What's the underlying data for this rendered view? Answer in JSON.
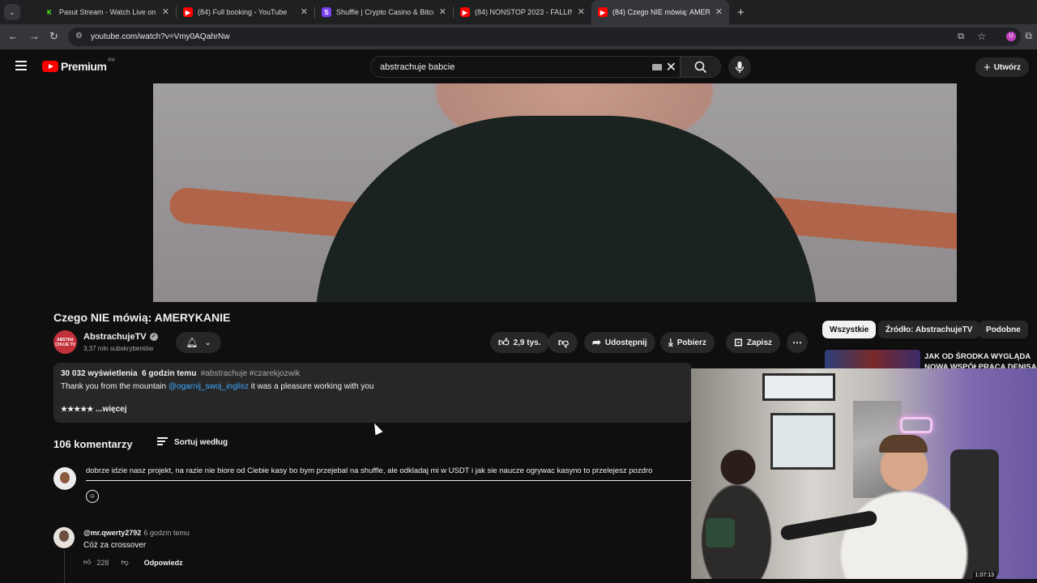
{
  "browser": {
    "tabs": [
      {
        "title": "Pasut Stream - Watch Live on K",
        "favicon": "kick-icon",
        "color": "#53fc18",
        "glyph": "K"
      },
      {
        "title": "(84) Full booking - YouTube",
        "favicon": "youtube-icon",
        "color": "#ff0000",
        "glyph": "▶"
      },
      {
        "title": "Shuffle | Crypto Casino & Bitco",
        "favicon": "shuffle-icon",
        "color": "#7b3ff2",
        "glyph": "S"
      },
      {
        "title": "(84) NONSTOP 2023 - FALLING",
        "favicon": "youtube-icon",
        "color": "#ff0000",
        "glyph": "▶"
      },
      {
        "title": "(84) Czego NIE mówią: AMERYK",
        "favicon": "youtube-icon",
        "color": "#ff0000",
        "glyph": "▶"
      }
    ],
    "url": "youtube.com/watch?v=Vmy0AQahrNw"
  },
  "yt": {
    "logo_text": "Premium",
    "logo_region": "PH",
    "search_value": "abstrachuje babcie",
    "create_label": "Utwórz"
  },
  "video": {
    "title": "Czego NIE mówią: AMERYKANIE",
    "channel": "AbstrachujeTV",
    "channel_avatar_text": "ABSTRA CHUJE TV",
    "subscribers": "3,37 mln subskrybentów",
    "likes": "2,9 tys.",
    "share": "Udostępnij",
    "download": "Pobierz",
    "save": "Zapisz"
  },
  "description": {
    "views": "30 032 wyświetlenia",
    "age": "6 godzin temu",
    "tags": "#abstrachuje #czarekjozwik",
    "text_before": "Thank you from the mountain ",
    "mention": "@ogarnij_swoj_inglisz",
    "text_after": "  it was a pleasure working with you",
    "stars": "★★★★★",
    "more": "...więcej"
  },
  "comments": {
    "count": "106 komentarzy",
    "sort_label": "Sortuj według",
    "draft": "dobrze idzie nasz projekt, na razie nie biore od Ciebie kasy bo bym przejebal na shuffle, ale odkladaj mi w USDT i jak sie naucze ogrywac kasyno to przelejesz pozdro",
    "items": [
      {
        "author": "@mr.qwerty2792",
        "time": "6 godzin temu",
        "text": "Cóż za crossover",
        "likes": "228",
        "reply": "Odpowiedz"
      }
    ]
  },
  "sidebar": {
    "chips": [
      "Wszystkie",
      "Źródło: AbstrachujeTV",
      "Podobne"
    ],
    "rec_title": "JAK OD ŚRODKA WYGLĄDA NOWA WSPÓŁPRACA DENISA"
  },
  "cam": {
    "timestamp": "1:07:13"
  }
}
